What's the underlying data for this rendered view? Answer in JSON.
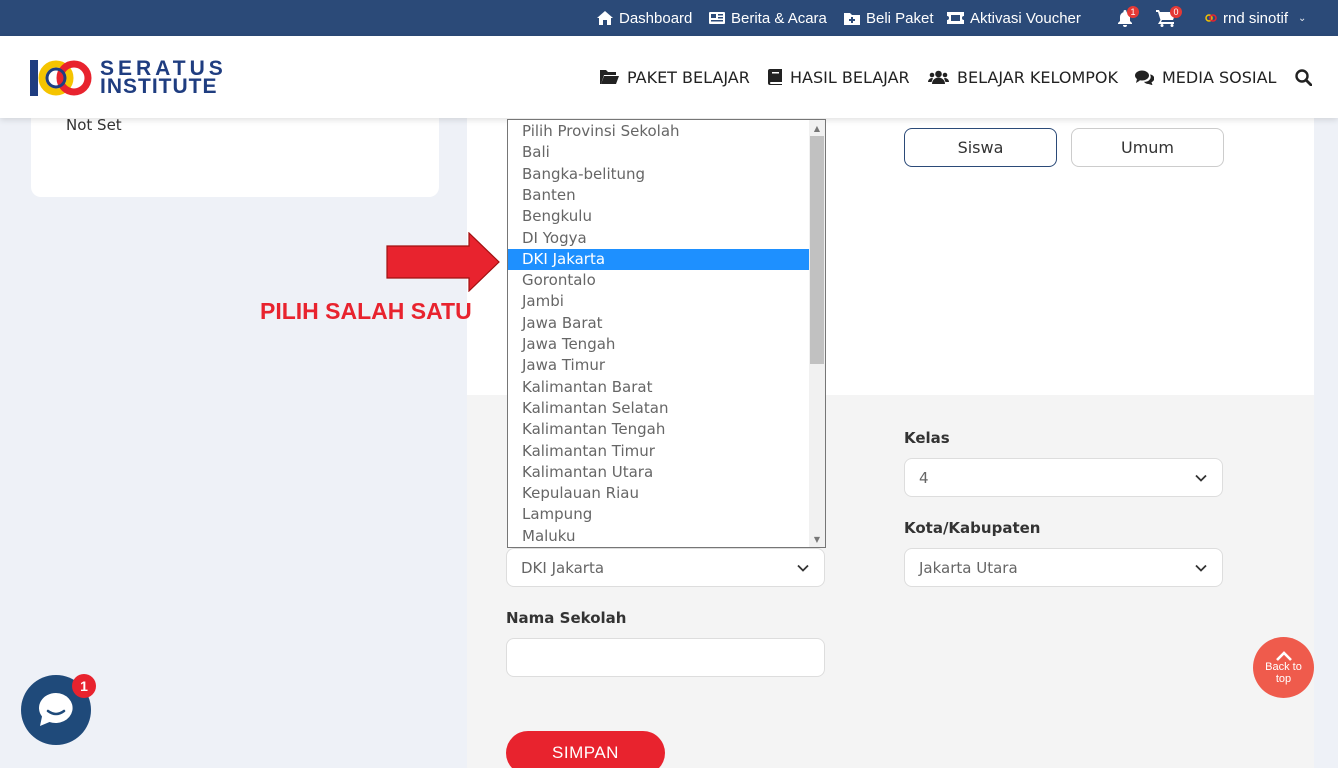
{
  "topbar": {
    "dashboard": "Dashboard",
    "news": "Berita & Acara",
    "buy_package": "Beli Paket",
    "voucher": "Aktivasi Voucher",
    "notif_count": "1",
    "cart_count": "0",
    "user_name": "rnd sinotif"
  },
  "header": {
    "logo_line1": "SERATUS",
    "logo_line2": "INSTITUTE",
    "nav": {
      "packages": "PAKET BELAJAR",
      "results": "HASIL BELAJAR",
      "group": "BELAJAR KELOMPOK",
      "social": "MEDIA SOSIAL"
    }
  },
  "profile": {
    "not_set": "Not Set"
  },
  "role_buttons": {
    "student": "Siswa",
    "general": "Umum"
  },
  "form": {
    "kelas_label": "Kelas",
    "kelas_value": "4",
    "province_value": "DKI Jakarta",
    "city_label": "Kota/Kabupaten",
    "city_value": "Jakarta Utara",
    "school_label": "Nama Sekolah",
    "school_value": "",
    "submit": "SIMPAN"
  },
  "dropdown": {
    "options": [
      "Pilih Provinsi Sekolah",
      "Bali",
      "Bangka-belitung",
      "Banten",
      "Bengkulu",
      "DI Yogya",
      "DKI Jakarta",
      "Gorontalo",
      "Jambi",
      "Jawa Barat",
      "Jawa Tengah",
      "Jawa Timur",
      "Kalimantan Barat",
      "Kalimantan Selatan",
      "Kalimantan Tengah",
      "Kalimantan Timur",
      "Kalimantan Utara",
      "Kepulauan Riau",
      "Lampung",
      "Maluku"
    ],
    "selected_index": 6
  },
  "annotation": {
    "text": "PILIH SALAH SATU"
  },
  "widgets": {
    "chat_badge": "1",
    "back_to_top": "Back to top"
  },
  "colors": {
    "topbar": "#2b4a78",
    "accent_red": "#e8232e",
    "selected_blue": "#1e90ff",
    "back_to_top": "#ef5b4c"
  }
}
